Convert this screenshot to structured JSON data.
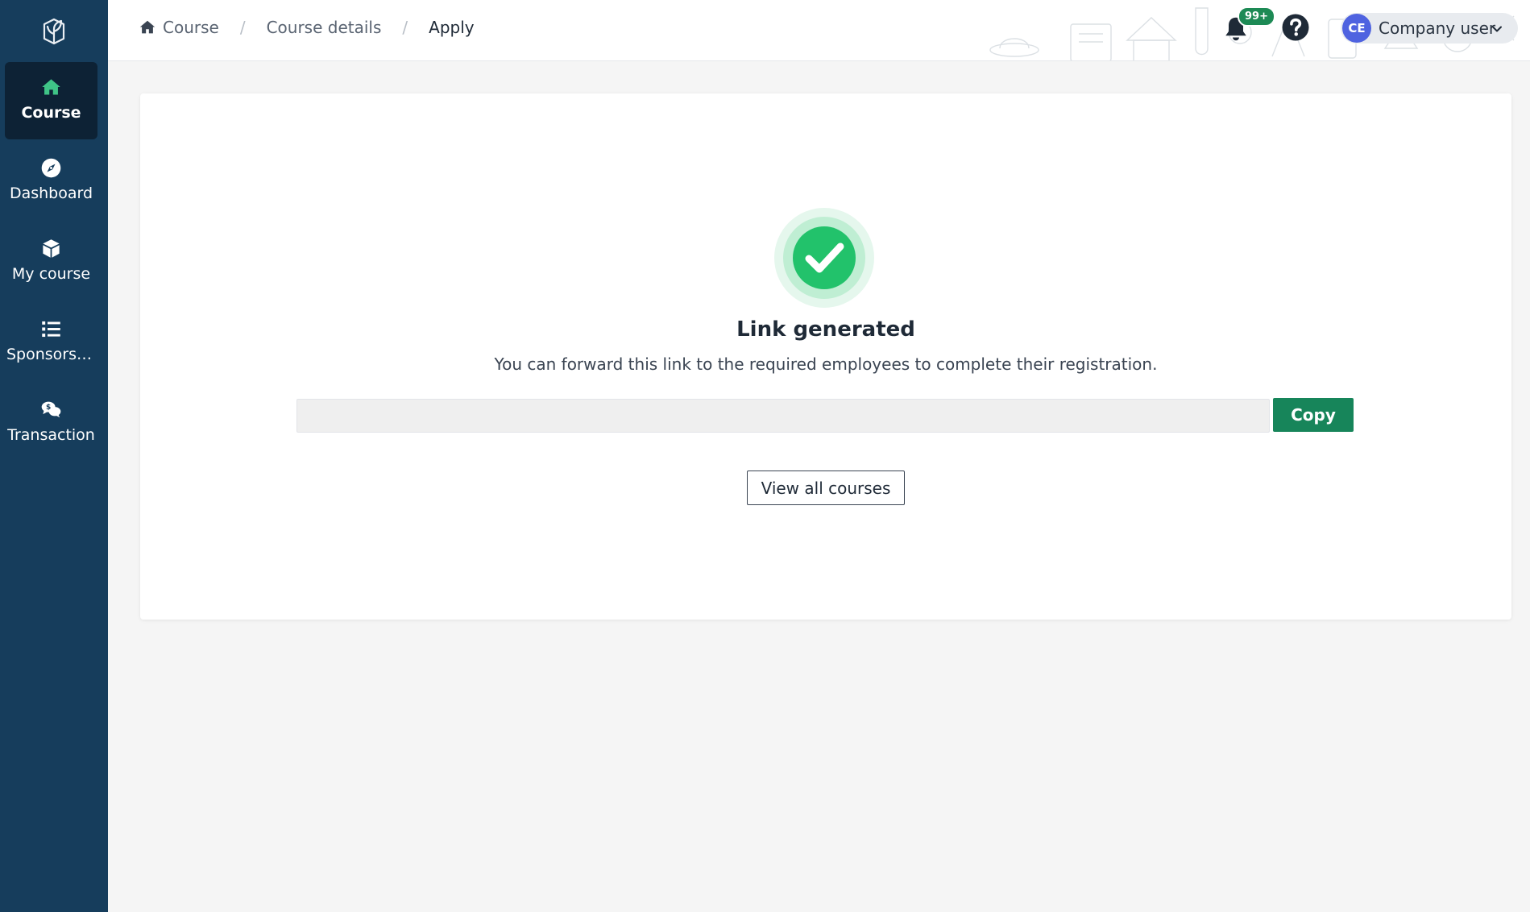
{
  "sidebar": {
    "logo_icon": "leaf-book-logo-icon",
    "items": [
      {
        "label": "Course",
        "icon": "home-icon",
        "active": true
      },
      {
        "label": "Dashboard",
        "icon": "compass-icon",
        "active": false
      },
      {
        "label": "My course",
        "icon": "cube-icon",
        "active": false
      },
      {
        "label": "Sponsorsh...",
        "icon": "list-icon",
        "active": false
      },
      {
        "label": "Transaction",
        "icon": "chat-dollar-icon",
        "active": false
      }
    ]
  },
  "header": {
    "breadcrumb": [
      {
        "label": "Course",
        "icon": "home-icon"
      },
      {
        "label": "Course details"
      },
      {
        "label": "Apply"
      }
    ],
    "separator": "/",
    "notifications_badge": "99+",
    "user": {
      "initials": "CE",
      "name": "Company user"
    }
  },
  "main": {
    "title": "Link generated",
    "subtitle": "You can forward this link to the required employees to complete their registration.",
    "link_value": "",
    "copy_label": "Copy",
    "view_all_label": "View all courses"
  },
  "colors": {
    "sidebar_bg": "#163d5c",
    "sidebar_active": "#0d2235",
    "accent_green": "#17855a",
    "success_green": "#22c26b",
    "avatar_blue": "#4f63e0"
  }
}
